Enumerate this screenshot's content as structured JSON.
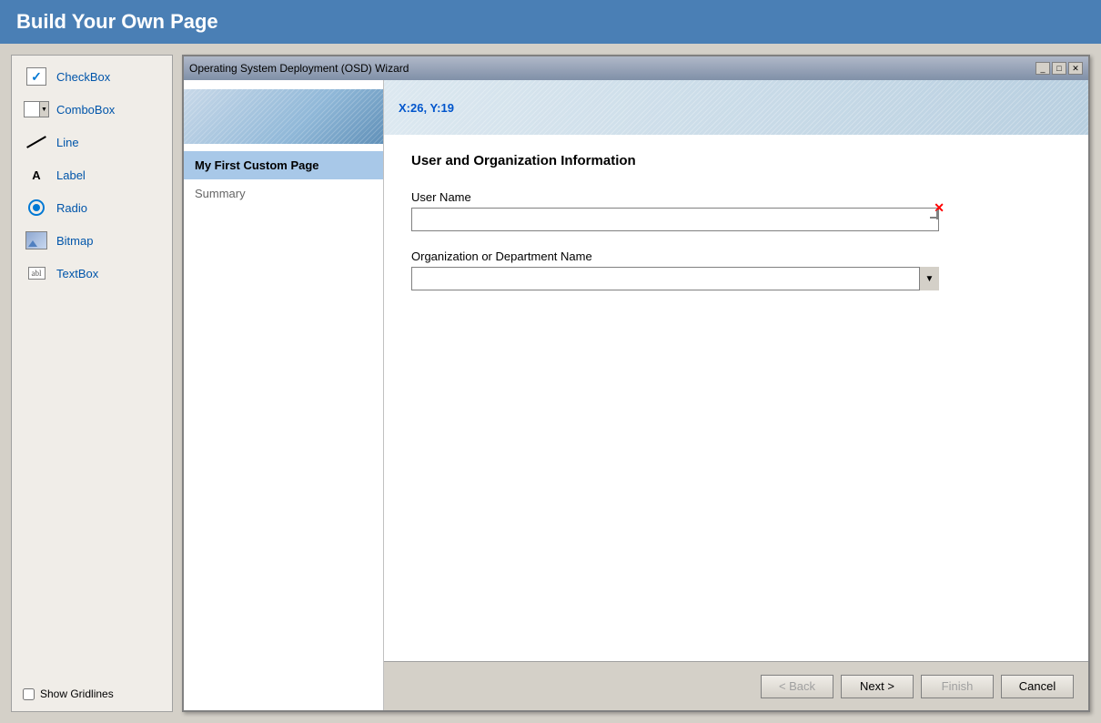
{
  "page": {
    "title": "Build Your Own Page"
  },
  "toolbox": {
    "items": [
      {
        "id": "checkbox",
        "label": "CheckBox",
        "icon": "checkbox-icon"
      },
      {
        "id": "combobox",
        "label": "ComboBox",
        "icon": "combobox-icon"
      },
      {
        "id": "line",
        "label": "Line",
        "icon": "line-icon"
      },
      {
        "id": "label",
        "label": "Label",
        "icon": "label-icon"
      },
      {
        "id": "radio",
        "label": "Radio",
        "icon": "radio-icon"
      },
      {
        "id": "bitmap",
        "label": "Bitmap",
        "icon": "bitmap-icon"
      },
      {
        "id": "textbox",
        "label": "TextBox",
        "icon": "textbox-icon"
      }
    ],
    "show_gridlines_label": "Show Gridlines"
  },
  "wizard": {
    "title": "Operating System Deployment (OSD) Wizard",
    "coords": "X:26, Y:19",
    "nav_items": [
      {
        "id": "custom-page",
        "label": "My First Custom Page",
        "active": true
      },
      {
        "id": "summary",
        "label": "Summary",
        "active": false
      }
    ],
    "section_title": "User and Organization Information",
    "fields": [
      {
        "id": "user-name",
        "label": "User Name",
        "type": "textbox",
        "value": "",
        "placeholder": ""
      },
      {
        "id": "org-name",
        "label": "Organization or Department Name",
        "type": "combobox",
        "value": "",
        "placeholder": ""
      }
    ],
    "buttons": {
      "back": "< Back",
      "next": "Next >",
      "finish": "Finish",
      "cancel": "Cancel"
    }
  }
}
